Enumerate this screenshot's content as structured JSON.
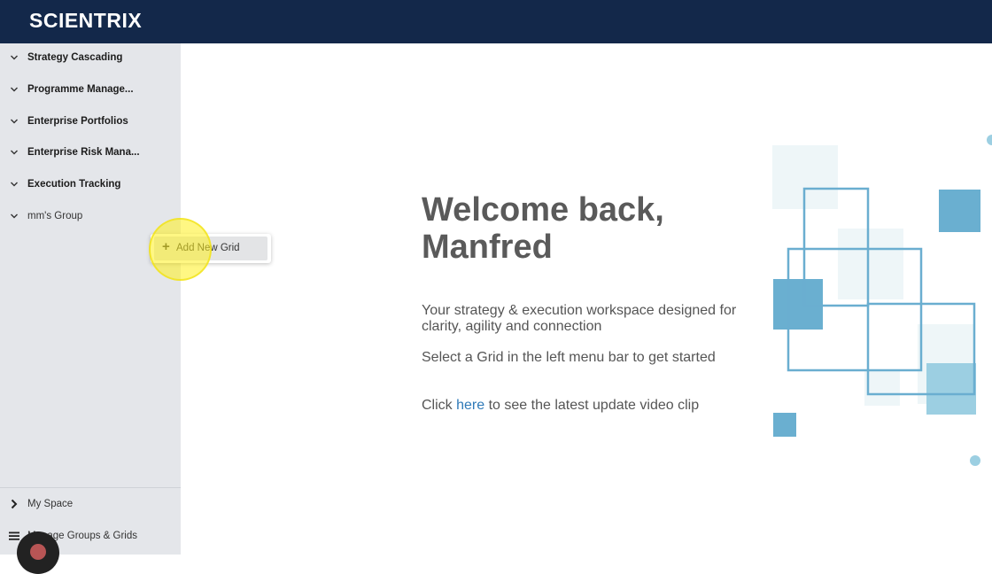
{
  "app": {
    "logo": "SCIENTRIX",
    "brand_color": "#13284a",
    "accent_color": "#5aa6c8"
  },
  "sidebar": {
    "items": [
      {
        "label": "Strategy Cascading",
        "icon": "chevron-down-icon"
      },
      {
        "label": "Programme Manage...",
        "icon": "chevron-down-icon"
      },
      {
        "label": "Enterprise Portfolios",
        "icon": "chevron-down-icon"
      },
      {
        "label": "Enterprise Risk Mana...",
        "icon": "chevron-down-icon"
      },
      {
        "label": "Execution Tracking",
        "icon": "chevron-down-icon"
      },
      {
        "label": "mm's Group",
        "icon": "chevron-down-icon"
      }
    ],
    "bottom": {
      "my_space": "My Space",
      "manage_groups": "Manage Groups & Grids"
    }
  },
  "popup": {
    "add_new_grid": "Add New Grid",
    "icon": "plus-icon"
  },
  "main": {
    "welcome_line1": "Welcome back,",
    "welcome_line2": "Manfred",
    "tagline_line1": "Your strategy & execution workspace designed for",
    "tagline_line2": "clarity, agility and connection",
    "instruction": "Select a Grid in the left menu bar to get started",
    "video_prefix": "Click",
    "video_link": "here",
    "video_suffix": "to see the latest update video clip"
  }
}
